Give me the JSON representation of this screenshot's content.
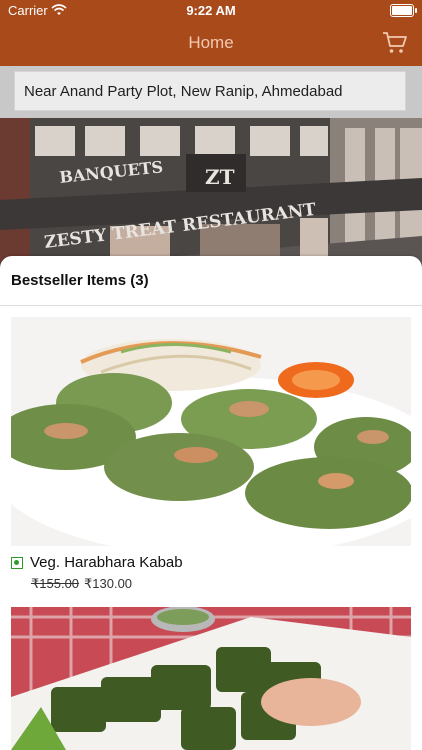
{
  "status": {
    "carrier": "Carrier",
    "time": "9:22 AM"
  },
  "nav": {
    "title": "Home"
  },
  "address": "Near Anand Party Plot, New Ranip, Ahmedabad",
  "hero": {
    "sign_banquets": "BANQUETS",
    "sign_restaurant": "ZESTY TREAT  RESTAURANT",
    "sign_logo": "ZT"
  },
  "bestseller": {
    "title": "Bestseller Items (3)",
    "items": [
      {
        "name": "Veg. Harabhara Kabab",
        "old_price": "₹155.00",
        "price": "₹130.00"
      }
    ]
  },
  "colors": {
    "brand": "#a94a1b",
    "veg": "#2e9a2e"
  }
}
